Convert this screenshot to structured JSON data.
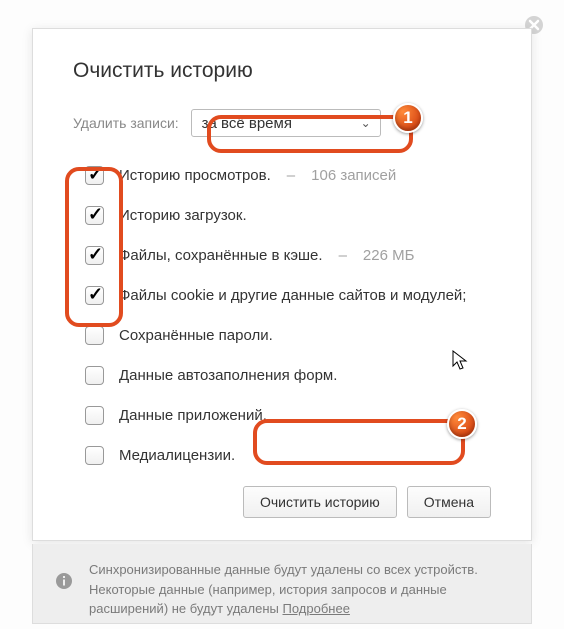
{
  "title": "Очистить историю",
  "select_label": "Удалить записи:",
  "time_options": [
    "за всё время"
  ],
  "time_selected": "за всё время",
  "items": [
    {
      "checked": true,
      "label": "Историю просмотров.",
      "sub": "106 записей"
    },
    {
      "checked": true,
      "label": "Историю загрузок.",
      "sub": ""
    },
    {
      "checked": true,
      "label": "Файлы, сохранённые в кэше.",
      "sub": "226 МБ"
    },
    {
      "checked": true,
      "label": "Файлы cookie и другие данные сайтов и модулей;",
      "sub": ""
    },
    {
      "checked": false,
      "label": "Сохранённые пароли.",
      "sub": ""
    },
    {
      "checked": false,
      "label": "Данные автозаполнения форм.",
      "sub": ""
    },
    {
      "checked": false,
      "label": "Данные приложений.",
      "sub": ""
    },
    {
      "checked": false,
      "label": "Медиалицензии.",
      "sub": ""
    }
  ],
  "buttons": {
    "clear": "Очистить историю",
    "cancel": "Отмена"
  },
  "footer": {
    "text_a": "Синхронизированные данные будут удалены со всех устройств.",
    "text_b": "Некоторые данные (например, история запросов и данные расширений) не будут удалены ",
    "more": "Подробнее"
  },
  "annotations": {
    "badge1": "1",
    "badge2": "2"
  }
}
